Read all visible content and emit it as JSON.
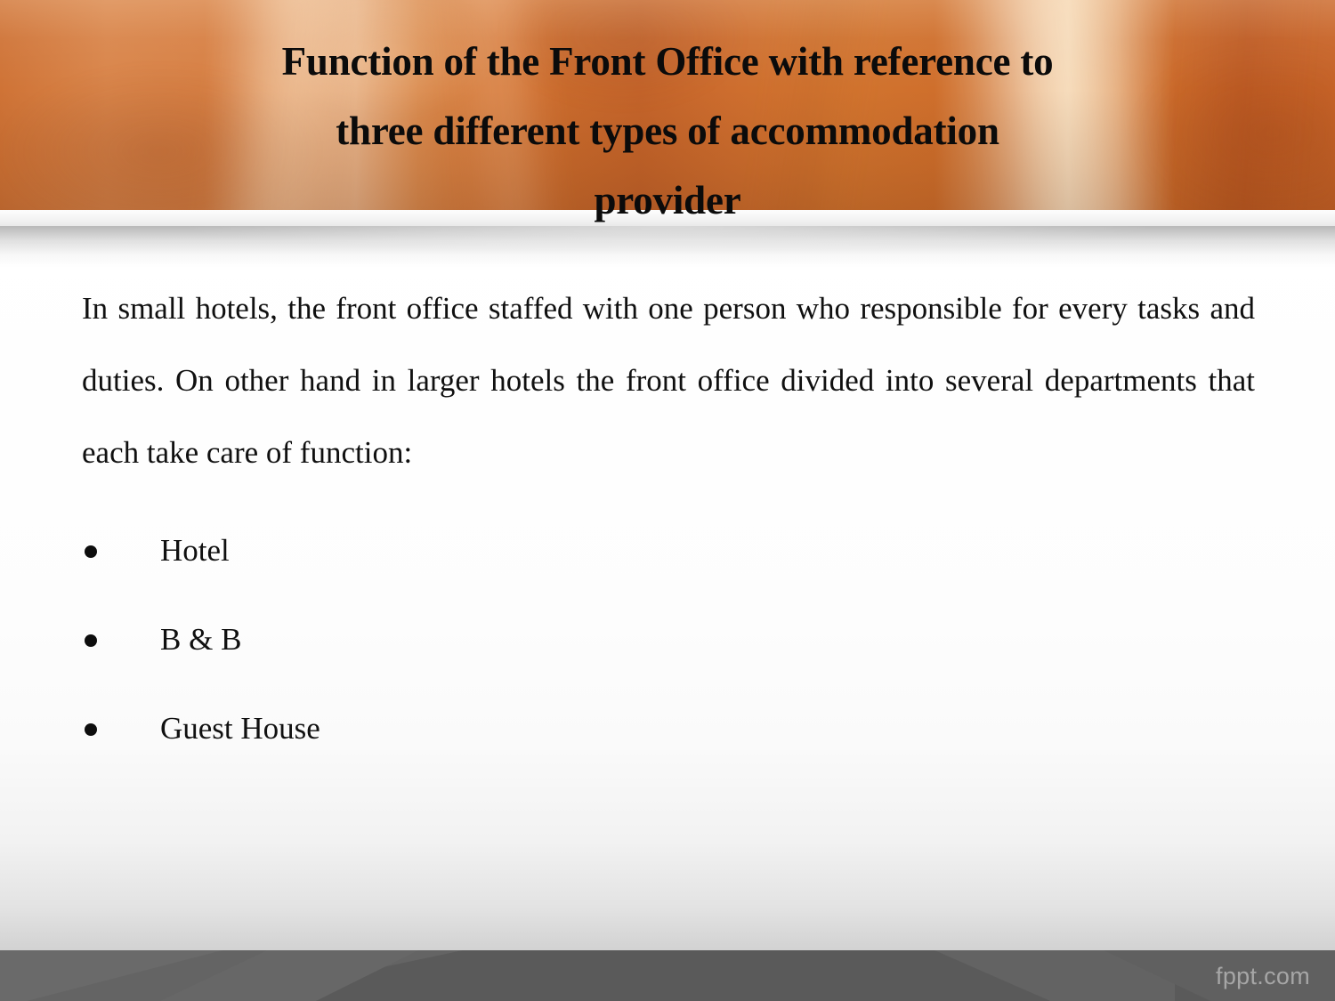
{
  "slide": {
    "header": {
      "title_lines": [
        "Function of the Front Office with reference to",
        "three different types of accommodation",
        "provider"
      ],
      "title_full": "Function of the Front Office with reference to three different types of accommodation provider",
      "background_color": "#d2702f",
      "accent_light": "#f0cfa8",
      "accent_dark": "#c35f25"
    },
    "body": {
      "paragraph": "In small hotels, the front office staffed with one person who responsible for every tasks and duties. On other hand in larger hotels the front office divided into several departments that each take care of function:",
      "bullets": [
        {
          "marker": "bullet-dot-icon",
          "label": "Hotel"
        },
        {
          "marker": "bullet-dot-icon",
          "label": "B & B"
        },
        {
          "marker": "bullet-dot-icon",
          "label": "Guest House"
        }
      ],
      "text_color": "#101010",
      "background_top": "#ffffff",
      "background_bottom": "#d2d2d2"
    },
    "footer": {
      "watermark": "fppt.com",
      "background_color": "#5a5a5a",
      "watermark_color": "#a6a6a6"
    }
  }
}
